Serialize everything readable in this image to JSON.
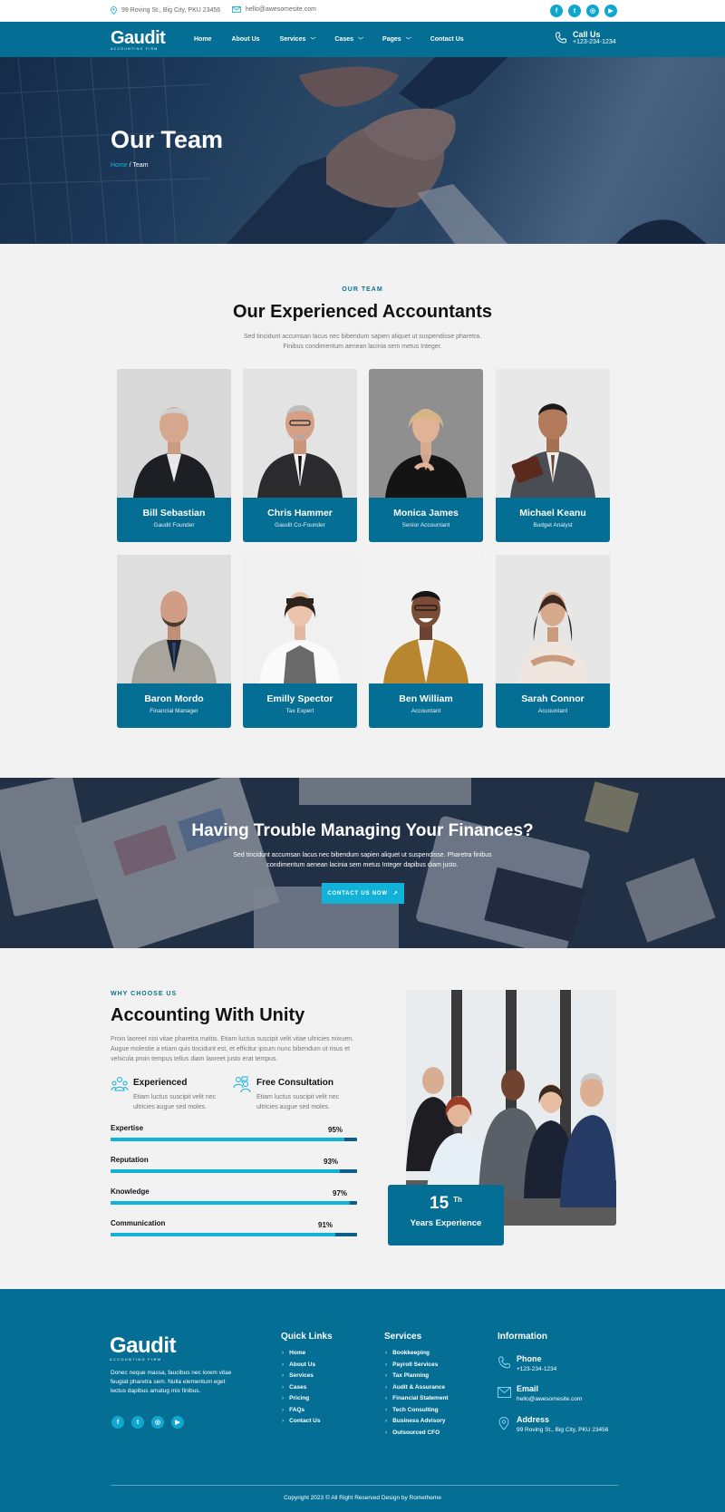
{
  "topbar": {
    "address": "99 Roving St., Big City, PKU 23456",
    "email": "hello@awesomesite.com",
    "social_icons": [
      "facebook-icon",
      "twitter-icon",
      "instagram-icon",
      "youtube-icon"
    ]
  },
  "brand": {
    "name": "Gaudit",
    "tagline": "ACCOUNTING FIRM"
  },
  "nav": {
    "items": [
      "Home",
      "About Us",
      "Services",
      "Cases",
      "Pages",
      "Contact Us"
    ],
    "call_title": "Call Us",
    "call_number": "+123-234-1234"
  },
  "hero": {
    "title": "Our Team",
    "crumb_home": "Home",
    "crumb_sep": " / ",
    "crumb_current": "Team"
  },
  "team": {
    "eyebrow": "OUR TEAM",
    "title": "Our Experienced Accountants",
    "desc_line1": "Sed tincidunt accumsan lacus nec bibendum sapien aliquet ut suspendisse pharetra.",
    "desc_line2": "Finibus condimentum aenean lacinia sem metus Integer.",
    "members": [
      {
        "name": "Bill Sebastian",
        "role": "Gaudit Founder"
      },
      {
        "name": "Chris Hammer",
        "role": "Gaudit Co-Founder"
      },
      {
        "name": "Monica James",
        "role": "Senior Accountant"
      },
      {
        "name": "Michael Keanu",
        "role": "Budget Analyst"
      },
      {
        "name": "Baron Mordo",
        "role": "Financial Manager"
      },
      {
        "name": "Emilly Spector",
        "role": "Tax Expert"
      },
      {
        "name": "Ben William",
        "role": "Accountant"
      },
      {
        "name": "Sarah Connor",
        "role": "Accountant"
      }
    ]
  },
  "cta": {
    "title": "Having Trouble Managing Your Finances?",
    "desc_line1": "Sed tincidunt accumsan lacus nec bibendum sapien aliquet ut suspendisse. Pharetra finibus",
    "desc_line2": "condimentum aenean lacinia sem metus Integer dapibus diam justo.",
    "button": "CONTACT US NOW"
  },
  "why": {
    "eyebrow": "WHY CHOOSE US",
    "title": "Accounting With Unity",
    "desc_line1": "Proin laoreet nisi vitae pharetra mattis. Etiam luctus suscipit velit vitae ultricies mixuen.",
    "desc_line2": "Augue molestie a etiam quis tincidunt est, et efficitur ipsum nunc bibendum ut risus et",
    "desc_line3": "vehicula proin tempus tellus diam laoreet justo erat tempus.",
    "features": [
      {
        "title": "Experienced",
        "line1": "Etiam luctus suscipit velit nec",
        "line2": "ultricies augue sed moles."
      },
      {
        "title": "Free Consultation",
        "line1": "Etiam luctus suscipit velit nec",
        "line2": "ultricies augue sed moles."
      }
    ],
    "skills": [
      {
        "label": "Expertise",
        "percent": "95%",
        "value": 95
      },
      {
        "label": "Reputation",
        "percent": "93%",
        "value": 93
      },
      {
        "label": "Knowledge",
        "percent": "97%",
        "value": 97
      },
      {
        "label": "Communication",
        "percent": "91%",
        "value": 91
      }
    ],
    "experience_number": "15",
    "experience_sup": "Th",
    "experience_label": "Years Experience"
  },
  "footer": {
    "about_line1": "Donec neque massa, faucibus nec lorem vitae",
    "about_line2": "feugiat pharetra sem. Nulla elementum eget",
    "about_line3": "lectus dapibus amatug mix finibus.",
    "quick_title": "Quick Links",
    "quick_links": [
      "Home",
      "About Us",
      "Services",
      "Cases",
      "Pricing",
      "FAQs",
      "Contact Us"
    ],
    "services_title": "Services",
    "services": [
      "Bookkeeping",
      "Payroll Services",
      "Tax Planning",
      "Audit & Assurance",
      "Financial Statement",
      "Tech Consulting",
      "Business Advisory",
      "Outsourced CFO"
    ],
    "info_title": "Information",
    "phone_label": "Phone",
    "phone": "+123-234-1234",
    "email_label": "Email",
    "email": "hello@awesomesite.com",
    "address_label": "Address",
    "address": "99 Roving St., Big City, PKU 23456",
    "copyright": "Copyright 2023 © All Right Reserved Design by Rometheme"
  },
  "colors": {
    "primary": "#056e94",
    "accent": "#12b2d8",
    "background": "#f2f2f2"
  }
}
